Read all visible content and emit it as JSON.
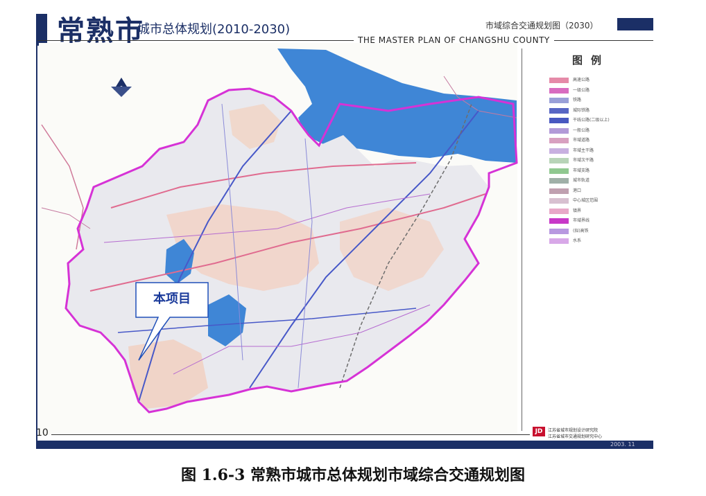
{
  "header": {
    "brand": "常熟市",
    "subtitle": "城市总体规划(2010-2030)",
    "right_title": "市域综合交通规划图（2030）",
    "english_title": "THE MASTER PLAN OF CHANGSHU COUNTY"
  },
  "legend": {
    "title": "图例",
    "items": [
      {
        "label": "高速公路",
        "color": "#e58aa8"
      },
      {
        "label": "一级公路",
        "color": "#d86cc0"
      },
      {
        "label": "铁路",
        "color": "#9aa0d8"
      },
      {
        "label": "城际铁路",
        "color": "#5866c4"
      },
      {
        "label": "干线公路(二级以上)",
        "color": "#4858c0"
      },
      {
        "label": "一般公路",
        "color": "#b29ad8"
      },
      {
        "label": "市域道路",
        "color": "#d8a0c0"
      },
      {
        "label": "市域主干路",
        "color": "#c8b0e0"
      },
      {
        "label": "市域次干路",
        "color": "#b8d4b8"
      },
      {
        "label": "市域支路",
        "color": "#90c890"
      },
      {
        "label": "城市轨道",
        "color": "#a0b0a8"
      },
      {
        "label": "港口",
        "color": "#c0a0b0"
      },
      {
        "label": "中心城区范围",
        "color": "#d8c0d0"
      },
      {
        "label": "镇界",
        "color": "#e8a8c8"
      },
      {
        "label": "市域界线",
        "color": "#c838c8"
      },
      {
        "label": "(拟)高铁",
        "color": "#b898e0"
      },
      {
        "label": "水系",
        "color": "#d8a8e8"
      }
    ]
  },
  "map": {
    "callout_label": "本项目",
    "water_color": "#3f86d6",
    "boundary_color": "#d632d6"
  },
  "footer": {
    "page_number": "10",
    "logo": "JD",
    "institute_1": "江苏省城市规划设计研究院",
    "institute_2": "江苏省城市交通规划研究中心",
    "date": "2003. 11"
  },
  "caption": "图 1.6-3 常熟市城市总体规划市域综合交通规划图"
}
